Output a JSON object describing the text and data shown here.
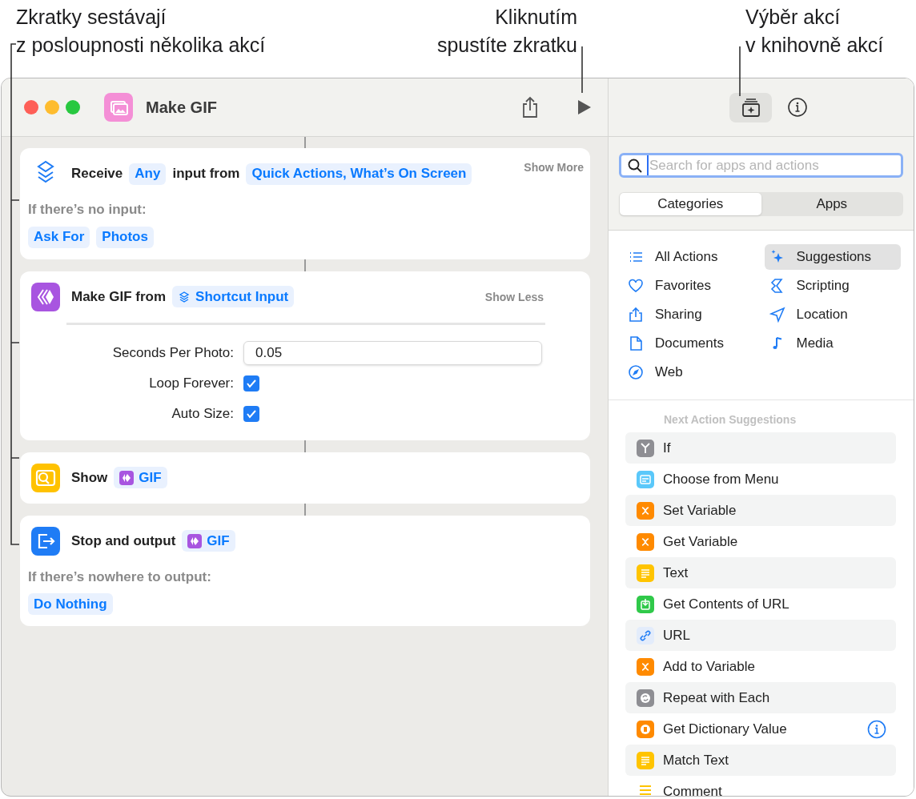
{
  "callouts": [
    {
      "text": "Zkratky sestávají\nz posloupnosti několika akcí"
    },
    {
      "text": "Kliknutím\nspustíte zkratku"
    },
    {
      "text": "Výběr akcí\nv knihovně akcí"
    }
  ],
  "window": {
    "title": "Make GIF"
  },
  "actions": [
    {
      "kind": "receive",
      "parts": [
        {
          "kind": "word",
          "text": "Receive"
        },
        {
          "kind": "token",
          "text": "Any"
        },
        {
          "kind": "word",
          "text": "input from"
        },
        {
          "kind": "token",
          "text": "Quick Actions, What’s On Screen"
        }
      ],
      "toggle": "Show More",
      "sub_label": "If there’s no input:",
      "sub_tokens": [
        "Ask For",
        "Photos"
      ]
    },
    {
      "kind": "gif",
      "parts": [
        {
          "kind": "word",
          "text": "Make GIF from"
        },
        {
          "kind": "input",
          "text": "Shortcut Input"
        }
      ],
      "toggle": "Show Less",
      "params": [
        {
          "kind": "field",
          "label": "Seconds Per Photo:",
          "value": "0.05"
        },
        {
          "kind": "checkbox",
          "label": "Loop Forever:",
          "checked": true
        },
        {
          "kind": "checkbox",
          "label": "Auto Size:",
          "checked": true
        }
      ]
    },
    {
      "kind": "show",
      "parts": [
        {
          "kind": "word",
          "text": "Show"
        },
        {
          "kind": "variable",
          "text": "GIF"
        }
      ]
    },
    {
      "kind": "output",
      "parts": [
        {
          "kind": "word",
          "text": "Stop and output"
        },
        {
          "kind": "variable",
          "text": "GIF"
        }
      ],
      "sub_label": "If there’s nowhere to output:",
      "sub_tokens": [
        "Do Nothing"
      ]
    }
  ],
  "toolbar": [
    {
      "selected": true
    },
    {
      "selected": false
    }
  ],
  "search": {
    "placeholder": "Search for apps and actions"
  },
  "segments": [
    {
      "label": "Categories",
      "selected": true
    },
    {
      "label": "Apps",
      "selected": false
    }
  ],
  "categories": [
    {
      "label": "All Actions",
      "selected": false
    },
    {
      "label": "Suggestions",
      "selected": true
    },
    {
      "label": "Favorites",
      "selected": false
    },
    {
      "label": "Scripting",
      "selected": false
    },
    {
      "label": "Sharing",
      "selected": false
    },
    {
      "label": "Location",
      "selected": false
    },
    {
      "label": "Documents",
      "selected": false
    },
    {
      "label": "Media",
      "selected": false
    },
    {
      "label": "Web",
      "selected": false
    }
  ],
  "suggestions": {
    "heading": "Next Action Suggestions",
    "items": [
      {
        "label": "If",
        "kind": "branch",
        "color": "#8e8e93"
      },
      {
        "label": "Choose from Menu",
        "kind": "menu",
        "color": "#5ac8fa"
      },
      {
        "label": "Set Variable",
        "kind": "variable",
        "color": "#ff8a00"
      },
      {
        "label": "Get Variable",
        "kind": "variable",
        "color": "#ff8a00"
      },
      {
        "label": "Text",
        "kind": "text",
        "color": "#ffc400"
      },
      {
        "label": "Get Contents of URL",
        "kind": "download",
        "color": "#30c94a"
      },
      {
        "label": "URL",
        "kind": "link",
        "color": "#e3ecfb"
      },
      {
        "label": "Add to Variable",
        "kind": "variable",
        "color": "#ff8a00"
      },
      {
        "label": "Repeat with Each",
        "kind": "repeat",
        "color": "#8e8e93"
      },
      {
        "label": "Get Dictionary Value",
        "kind": "dictionary",
        "color": "#ff8a00",
        "info": true
      },
      {
        "label": "Match Text",
        "kind": "text",
        "color": "#ffc400"
      },
      {
        "label": "Comment",
        "kind": "comment",
        "color": "#ffc400"
      }
    ]
  }
}
